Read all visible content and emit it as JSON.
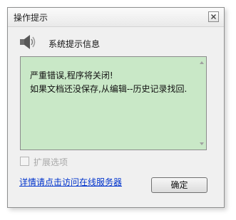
{
  "window": {
    "title": "操作提示"
  },
  "header": {
    "icon": "speaker-icon",
    "text": "系统提示信息"
  },
  "message": {
    "line1": "严重错误,程序将关闭!",
    "line2": "如果文档还没保存,从编辑--历史记录找回."
  },
  "options": {
    "expand_label": "扩展选项",
    "checked": false
  },
  "footer": {
    "link_text": "详情请点击访问在线服务器",
    "ok_label": "确定"
  },
  "colors": {
    "message_bg": "#c9e8c7",
    "link": "#0033cc",
    "dialog_bg": "#f0f0f0"
  }
}
